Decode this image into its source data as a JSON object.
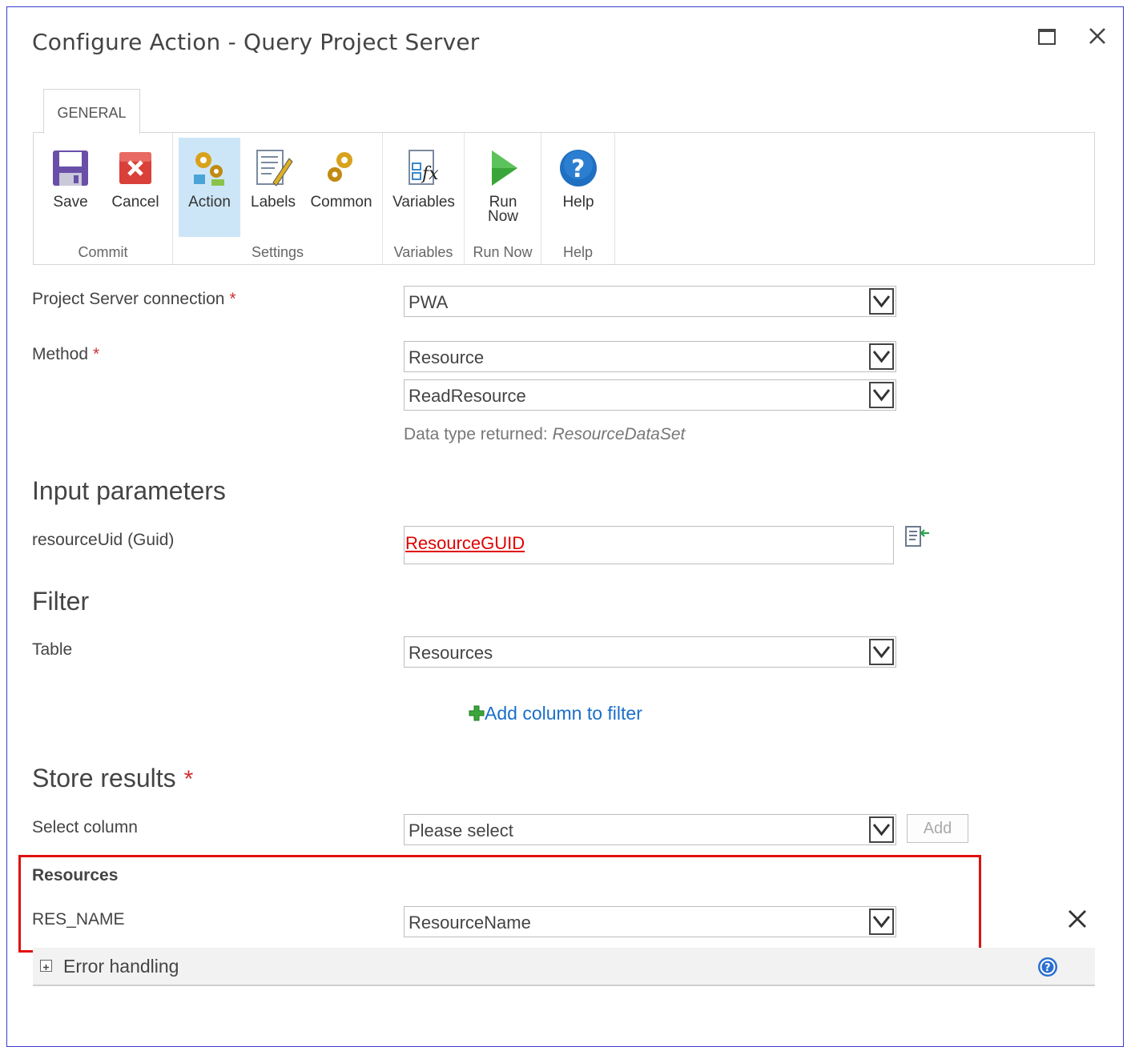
{
  "dialog": {
    "title": "Configure Action - Query Project Server"
  },
  "ribbon": {
    "tab": "GENERAL",
    "groups": {
      "commit": {
        "label": "Commit",
        "save": "Save",
        "cancel": "Cancel"
      },
      "settings": {
        "label": "Settings",
        "action": "Action",
        "labels": "Labels",
        "common": "Common"
      },
      "variables": {
        "label": "Variables",
        "variables": "Variables"
      },
      "run_now": {
        "label": "Run Now",
        "run_now_line1": "Run",
        "run_now_line2": "Now"
      },
      "help": {
        "label": "Help",
        "help": "Help"
      }
    }
  },
  "form": {
    "connection_label": "Project Server connection",
    "connection_value": "PWA",
    "method_label": "Method",
    "method_value": "Resource",
    "method_sub_value": "ReadResource",
    "data_type_prefix": "Data type returned:",
    "data_type_value": "ResourceDataSet",
    "required_mark": "*",
    "input_heading": "Input parameters",
    "resource_uid_label": "resourceUid",
    "resource_uid_type": "(Guid)",
    "resource_uid_value": "ResourceGUID",
    "filter_heading": "Filter",
    "table_label": "Table",
    "table_value": "Resources",
    "add_filter_link": "Add column to filter",
    "store_heading": "Store results",
    "select_column_label": "Select column",
    "select_column_value": "Please select",
    "add_button": "Add",
    "resources_heading": "Resources",
    "res_name_label": "RES_NAME",
    "res_name_value": "ResourceName",
    "error_handling_label": "Error handling"
  },
  "colors": {
    "selected_tab_bg": "#cde6f7",
    "link": "#1a6fc9",
    "required": "#cc3333",
    "highlight_border": "#e01010",
    "variable_text": "#e00000"
  }
}
